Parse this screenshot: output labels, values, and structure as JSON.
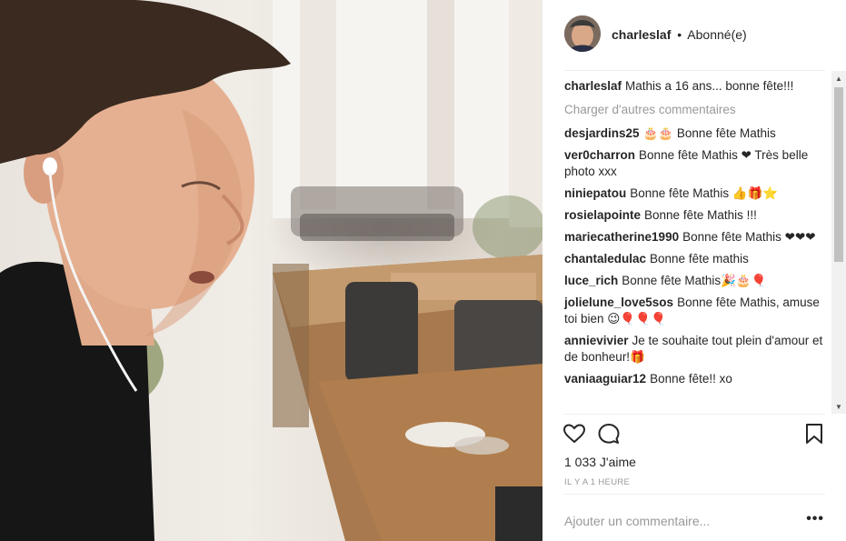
{
  "post": {
    "photo_alt": "photo",
    "username": "charleslaf",
    "separator": "•",
    "follow_status": "Abonné(e)"
  },
  "caption": {
    "author": "charleslaf",
    "text": "Mathis a 16 ans... bonne fête!!!"
  },
  "load_more_label": "Charger d'autres commentaires",
  "comments": [
    {
      "author": "desjardins25",
      "text": "🎂🎂 Bonne fête Mathis"
    },
    {
      "author": "ver0charron",
      "text": "Bonne fête Mathis ❤ Très belle photo xxx"
    },
    {
      "author": "niniepatou",
      "text": "Bonne fête Mathis 👍🎁⭐"
    },
    {
      "author": "rosielapointe",
      "text": "Bonne fête Mathis !!!"
    },
    {
      "author": "mariecatherine1990",
      "text": "Bonne fête Mathis ❤❤❤"
    },
    {
      "author": "chantaledulac",
      "text": "Bonne fête mathis"
    },
    {
      "author": "luce_rich",
      "text": "Bonne fête Mathis🎉🎂🎈"
    },
    {
      "author": "jolielune_love5sos",
      "text": "Bonne fête Mathis, amuse toi bien 😉🎈🎈🎈"
    },
    {
      "author": "annievivier",
      "text": "Je te souhaite tout plein d'amour et de bonheur!🎁"
    },
    {
      "author": "vaniaaguiar12",
      "text": "Bonne fête!! xo"
    }
  ],
  "scrollbar": {
    "up": "▲",
    "down": "▼"
  },
  "actions": {
    "like_icon": "heart-icon",
    "comment_icon": "comment-icon",
    "save_icon": "bookmark-icon"
  },
  "likes_label": "1 033 J'aime",
  "time_label": "IL Y A 1 HEURE",
  "add_comment": {
    "placeholder": "Ajouter un commentaire...",
    "more_label": "•••"
  }
}
